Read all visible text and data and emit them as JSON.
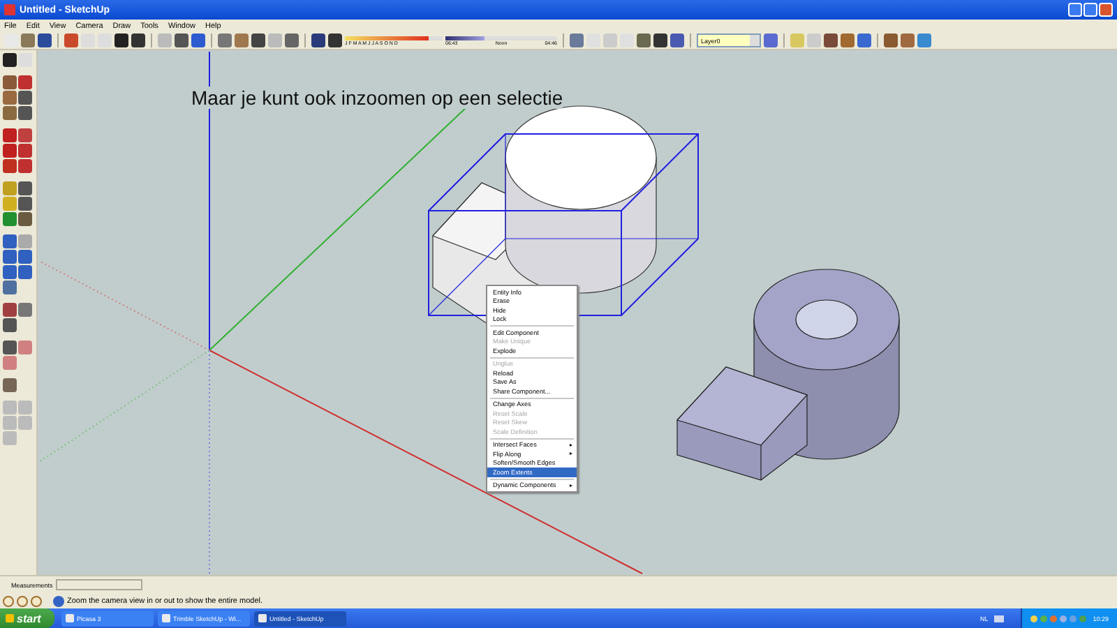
{
  "window": {
    "title": "Untitled - SketchUp"
  },
  "menu_bar": [
    "File",
    "Edit",
    "View",
    "Camera",
    "Draw",
    "Tools",
    "Window",
    "Help"
  ],
  "shadow_toolbar": {
    "months": "J F M A M J J A S O N D",
    "time_start": "06:43",
    "time_mid": "Noon",
    "time_end": "04:46",
    "date_slider": {
      "level": 0.85
    },
    "time_slider": {
      "level": 0.35
    }
  },
  "layer_dropdown": {
    "value": "Layer0"
  },
  "canvas": {
    "caption": "Maar je kunt ook inzoomen op een selectie"
  },
  "context_menu": {
    "groups": [
      [
        {
          "label": "Entity Info",
          "disabled": false,
          "submenu": false,
          "selected": false
        },
        {
          "label": "Erase",
          "disabled": false,
          "submenu": false,
          "selected": false
        },
        {
          "label": "Hide",
          "disabled": false,
          "submenu": false,
          "selected": false
        },
        {
          "label": "Lock",
          "disabled": false,
          "submenu": false,
          "selected": false
        }
      ],
      [
        {
          "label": "Edit Component",
          "disabled": false,
          "submenu": false,
          "selected": false
        },
        {
          "label": "Make Unique",
          "disabled": true,
          "submenu": false,
          "selected": false
        },
        {
          "label": "Explode",
          "disabled": false,
          "submenu": false,
          "selected": false
        }
      ],
      [
        {
          "label": "Unglue",
          "disabled": true,
          "submenu": false,
          "selected": false
        },
        {
          "label": "Reload",
          "disabled": false,
          "submenu": false,
          "selected": false
        },
        {
          "label": "Save As",
          "disabled": false,
          "submenu": false,
          "selected": false
        },
        {
          "label": "Share Component...",
          "disabled": false,
          "submenu": false,
          "selected": false
        }
      ],
      [
        {
          "label": "Change Axes",
          "disabled": false,
          "submenu": false,
          "selected": false
        },
        {
          "label": "Reset Scale",
          "disabled": true,
          "submenu": false,
          "selected": false
        },
        {
          "label": "Reset Skew",
          "disabled": true,
          "submenu": false,
          "selected": false
        },
        {
          "label": "Scale Definition",
          "disabled": true,
          "submenu": false,
          "selected": false
        }
      ],
      [
        {
          "label": "Intersect Faces",
          "disabled": false,
          "submenu": true,
          "selected": false
        },
        {
          "label": "Flip Along",
          "disabled": false,
          "submenu": true,
          "selected": false
        },
        {
          "label": "Soften/Smooth Edges",
          "disabled": false,
          "submenu": false,
          "selected": false
        },
        {
          "label": "Zoom Extents",
          "disabled": false,
          "submenu": false,
          "selected": true
        }
      ],
      [
        {
          "label": "Dynamic Components",
          "disabled": false,
          "submenu": true,
          "selected": false
        }
      ]
    ]
  },
  "measurements": {
    "label": "Measurements"
  },
  "status_bar": {
    "text": "Zoom the camera view in or out to show the entire model."
  },
  "taskbar": {
    "start": "start",
    "tasks": [
      {
        "label": "Picasa 3",
        "selected": false
      },
      {
        "label": "Trimble SketchUp - Wi...",
        "selected": false
      },
      {
        "label": "Untitled - SketchUp",
        "selected": true
      }
    ],
    "language": "NL",
    "time": "10:29"
  }
}
